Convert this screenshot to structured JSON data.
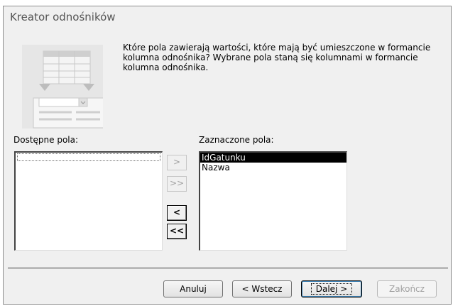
{
  "window": {
    "title": "Kreator odnośników"
  },
  "instructions": "Które pola zawierają wartości, które mają być umieszczone w formancie kolumna odnośnika? Wybrane pola staną się kolumnami w formancie kolumna odnośnika.",
  "available_fields": {
    "label": "Dostępne pola:",
    "items": []
  },
  "selected_fields": {
    "label": "Zaznaczone pola:",
    "items": [
      "IdGatunku",
      "Nazwa"
    ]
  },
  "move_buttons": {
    "add_one": ">",
    "add_all": ">>",
    "remove_one": "<",
    "remove_all": "<<"
  },
  "buttons": {
    "cancel": "Anuluj",
    "back": "< Wstecz",
    "next": "Dalej >",
    "finish": "Zakończ"
  }
}
